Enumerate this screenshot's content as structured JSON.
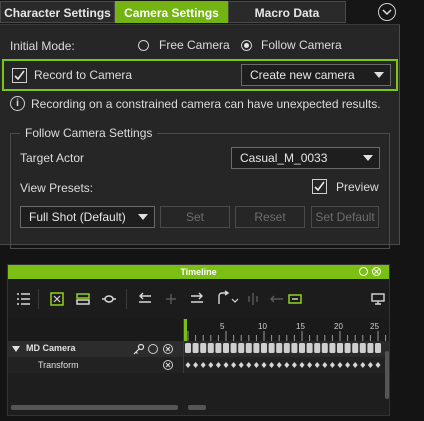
{
  "tabs": [
    {
      "label": "Character Settings",
      "active": false
    },
    {
      "label": "Camera Settings",
      "active": true
    },
    {
      "label": "Macro Data",
      "active": false
    }
  ],
  "initial_mode": {
    "label": "Initial Mode:",
    "options": [
      "Free Camera",
      "Follow Camera"
    ],
    "selected": "Follow Camera"
  },
  "record": {
    "label": "Record to Camera",
    "checked": true,
    "dropdown_value": "Create new camera"
  },
  "info_message": "Recording on a constrained camera can have unexpected results.",
  "follow_settings": {
    "title": "Follow Camera Settings",
    "target_actor_label": "Target Actor",
    "target_actor_value": "Casual_M_0033",
    "view_presets_label": "View Presets:",
    "preview_label": "Preview",
    "preview_checked": true,
    "preset_value": "Full Shot (Default)",
    "buttons": [
      "Set",
      "Reset",
      "Set Default"
    ]
  },
  "timeline": {
    "title": "Timeline",
    "ruler_ticks": [
      "5",
      "10",
      "15",
      "20",
      "25"
    ],
    "tracks": [
      {
        "label": "MD Camera"
      },
      {
        "label": "Transform"
      }
    ]
  },
  "colors": {
    "accent": "#73b312",
    "highlight_border": "#7cc61a",
    "panel_bg": "#262626"
  }
}
